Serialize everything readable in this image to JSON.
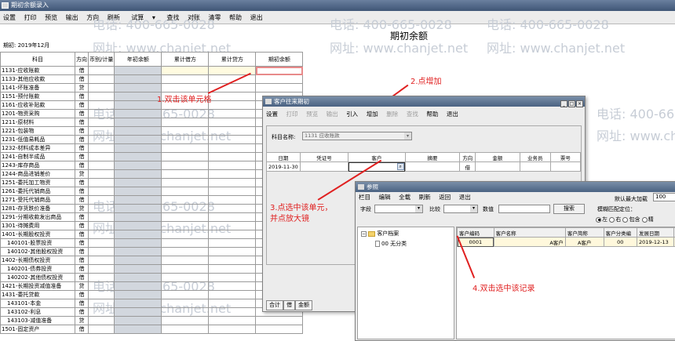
{
  "window": {
    "title": "期初余额录入"
  },
  "menubar": [
    "设置",
    "打印",
    "预览",
    "输出",
    "方向",
    "刷新",
    "试算",
    "查找",
    "对账",
    "清零",
    "帮助",
    "退出"
  ],
  "watermark": {
    "phone": "电话: 400-665-0028",
    "site": "网址: www.chanjet.net"
  },
  "page": {
    "title": "期初余额",
    "period": "期初: 2019年12月"
  },
  "table": {
    "headers": {
      "subject": "科目",
      "direction": "方向",
      "currency": "币别/计量",
      "opening": "年初余额",
      "debit": "累计借方",
      "credit": "累计贷方",
      "balance": "期初余额"
    },
    "rows": [
      {
        "subject": "1131-应收账款",
        "dir": "借"
      },
      {
        "subject": "1133-其他应收款",
        "dir": "借"
      },
      {
        "subject": "1141-坏账准备",
        "dir": "贷"
      },
      {
        "subject": "1151-预付账款",
        "dir": "借"
      },
      {
        "subject": "1161-应收补贴款",
        "dir": "借"
      },
      {
        "subject": "1201-物资采购",
        "dir": "借"
      },
      {
        "subject": "1211-原材料",
        "dir": "借"
      },
      {
        "subject": "1221-包装物",
        "dir": "借"
      },
      {
        "subject": "1231-低值易耗品",
        "dir": "借"
      },
      {
        "subject": "1232-材料成本差异",
        "dir": "借"
      },
      {
        "subject": "1241-自制半成品",
        "dir": "借"
      },
      {
        "subject": "1243-库存商品",
        "dir": "借"
      },
      {
        "subject": "1244-商品进销差价",
        "dir": "贷"
      },
      {
        "subject": "1251-委托加工物资",
        "dir": "借"
      },
      {
        "subject": "1261-委托代销商品",
        "dir": "借"
      },
      {
        "subject": "1271-受托代销商品",
        "dir": "借"
      },
      {
        "subject": "1281-存货跌价准备",
        "dir": "贷"
      },
      {
        "subject": "1291-分期收款发出商品",
        "dir": "借"
      },
      {
        "subject": "1301-待摊费用",
        "dir": "借"
      },
      {
        "subject": "1401-长期股权投资",
        "dir": "借"
      },
      {
        "subject": "140101-股票投资",
        "dir": "借"
      },
      {
        "subject": "140102-其他股权投资",
        "dir": "借"
      },
      {
        "subject": "1402-长期债权投资",
        "dir": "借"
      },
      {
        "subject": "140201-债券投资",
        "dir": "借"
      },
      {
        "subject": "140202-其他债权投资",
        "dir": "借"
      },
      {
        "subject": "1421-长期投资减值准备",
        "dir": "贷"
      },
      {
        "subject": "1431-委托贷款",
        "dir": "借"
      },
      {
        "subject": "143101-本金",
        "dir": "借"
      },
      {
        "subject": "143102-利息",
        "dir": "借"
      },
      {
        "subject": "143103-减值准备",
        "dir": "贷"
      },
      {
        "subject": "1501-固定资产",
        "dir": "借"
      }
    ]
  },
  "annotations": {
    "step1": "1.双击该单元格",
    "step2": "2.点增加",
    "step3a": "3.点选中该单元，",
    "step3b": "并点放大镜",
    "step4": "4.双击选中该记录"
  },
  "customer_dialog": {
    "title": "客户往来期初",
    "menu": [
      "设置",
      "打印",
      "预览",
      "输出",
      "引入",
      "增加",
      "删除",
      "查找",
      "帮助",
      "退出"
    ],
    "subject_label": "科目名称:",
    "subject_value": "1131 应收账款",
    "headers": [
      "日期",
      "凭证号",
      "客户",
      "摘要",
      "方向",
      "金额",
      "业务员",
      "票号"
    ],
    "row": {
      "date": "2019-11-30",
      "dir": "借"
    },
    "footer": [
      "合计",
      "借",
      "金额"
    ]
  },
  "ref_dialog": {
    "title": "参照",
    "menu": [
      "栏目",
      "编辑",
      "全载",
      "刷新",
      "返回",
      "退出"
    ],
    "max_load_label": "默认最大加载",
    "max_load_value": "100",
    "field_label": "字段",
    "compare_label": "比较",
    "value_label": "数值",
    "search_button": "搜索",
    "fuzzy_label": "模糊匹配定位：",
    "radio_left": "左",
    "radio_right": "右",
    "radio_contains": "包含",
    "radio_exact": "精",
    "tree_root": "客户档案",
    "tree_child": "00 无分类",
    "headers": [
      "客户编码",
      "客户名称",
      "客户简称",
      "客户分类编",
      "发展日期",
      "停用"
    ],
    "record": {
      "code": "0001",
      "name": "A客户",
      "short": "A客户",
      "cat": "00",
      "date": "2019-12-13"
    }
  }
}
